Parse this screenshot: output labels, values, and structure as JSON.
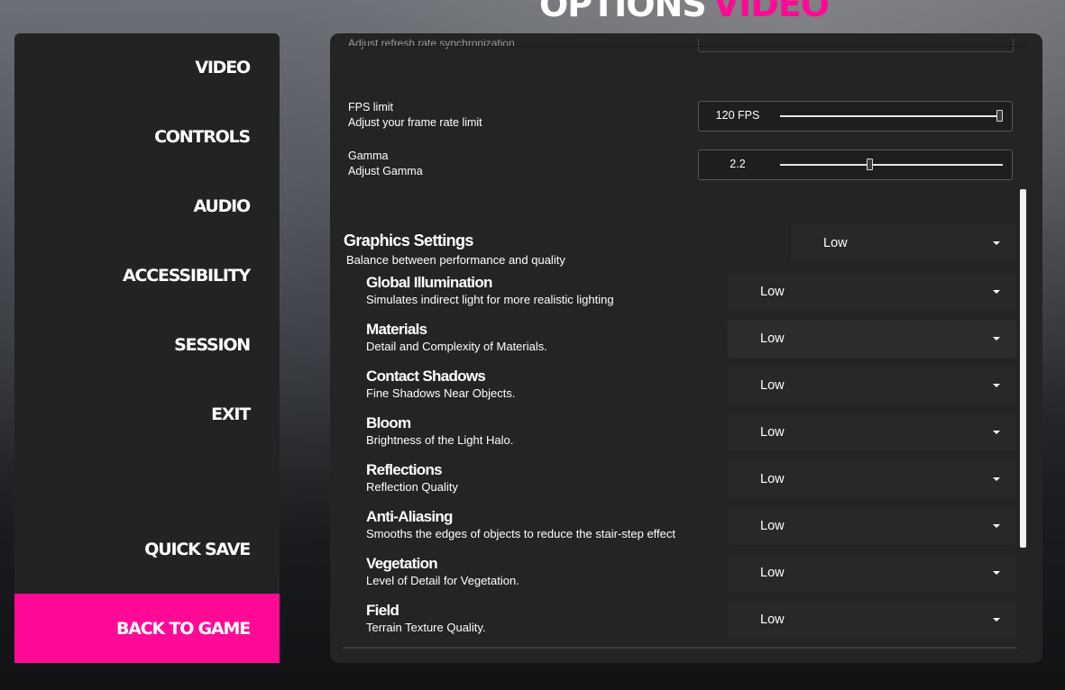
{
  "header": {
    "title": "OPTIONS",
    "section": "VIDEO"
  },
  "sidebar": {
    "items": [
      {
        "label": "VIDEO"
      },
      {
        "label": "CONTROLS"
      },
      {
        "label": "AUDIO"
      },
      {
        "label": "ACCESSIBILITY"
      },
      {
        "label": "SESSION"
      },
      {
        "label": "EXIT"
      },
      {
        "label": "QUICK SAVE"
      }
    ],
    "back_label": "BACK TO GAME"
  },
  "panel": {
    "cut_row_label": "Adjust refresh rate synchronization",
    "fps": {
      "title": "FPS limit",
      "desc": "Adjust your frame rate limit",
      "value": "120 FPS",
      "level": 1.0
    },
    "gamma": {
      "title": "Gamma",
      "desc": "Adjust Gamma",
      "value": "2.2",
      "level": 0.4
    },
    "graphics": {
      "title": "Graphics Settings",
      "desc": "Balance between performance and quality",
      "value": "Low",
      "items": [
        {
          "title": "Global Illumination",
          "desc": "Simulates indirect light for more realistic lighting",
          "value": "Low"
        },
        {
          "title": "Materials",
          "desc": "Detail and Complexity of Materials.",
          "value": "Low"
        },
        {
          "title": "Contact Shadows",
          "desc": "Fine Shadows Near Objects.",
          "value": "Low"
        },
        {
          "title": "Bloom",
          "desc": "Brightness of the Light Halo.",
          "value": "Low"
        },
        {
          "title": "Reflections",
          "desc": "Reflection Quality",
          "value": "Low"
        },
        {
          "title": "Anti-Aliasing",
          "desc": "Smooths the edges of objects to reduce the stair-step effect",
          "value": "Low"
        },
        {
          "title": "Vegetation",
          "desc": "Level of Detail for Vegetation.",
          "value": "Low"
        },
        {
          "title": "Field",
          "desc": "Terrain Texture Quality.",
          "value": "Low"
        }
      ]
    }
  },
  "colors": {
    "accent": "#ff0a96",
    "panel_bg": "#242424",
    "sidebar_bg": "#232323"
  }
}
